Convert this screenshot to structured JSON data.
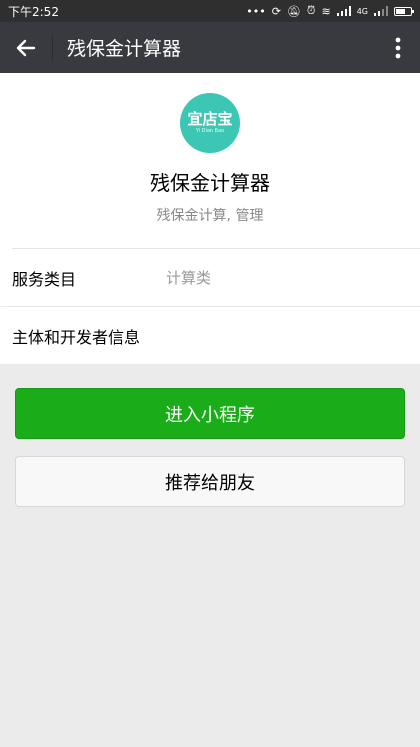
{
  "status_bar": {
    "time": "下午2:52",
    "icons": [
      "more-dots-icon",
      "sync-icon",
      "mute-icon",
      "alarm-icon",
      "vibrate-icon",
      "signal-icon",
      "4g-icon",
      "signal-icon",
      "battery-icon"
    ],
    "network_label": "4G"
  },
  "nav": {
    "title": "残保金计算器",
    "back_icon": "back-arrow-icon",
    "more_icon": "more-vertical-icon"
  },
  "profile": {
    "logo_text": "宜店宝",
    "logo_subtext": "Yi Dian Bao",
    "logo_color": "#3cc6b4",
    "name": "残保金计算器",
    "description": "残保金计算, 管理"
  },
  "rows": {
    "category_label": "服务类目",
    "category_value": "计算类",
    "developer_label": "主体和开发者信息"
  },
  "buttons": {
    "enter_label": "进入小程序",
    "share_label": "推荐给朋友",
    "primary_color": "#1aad19"
  }
}
